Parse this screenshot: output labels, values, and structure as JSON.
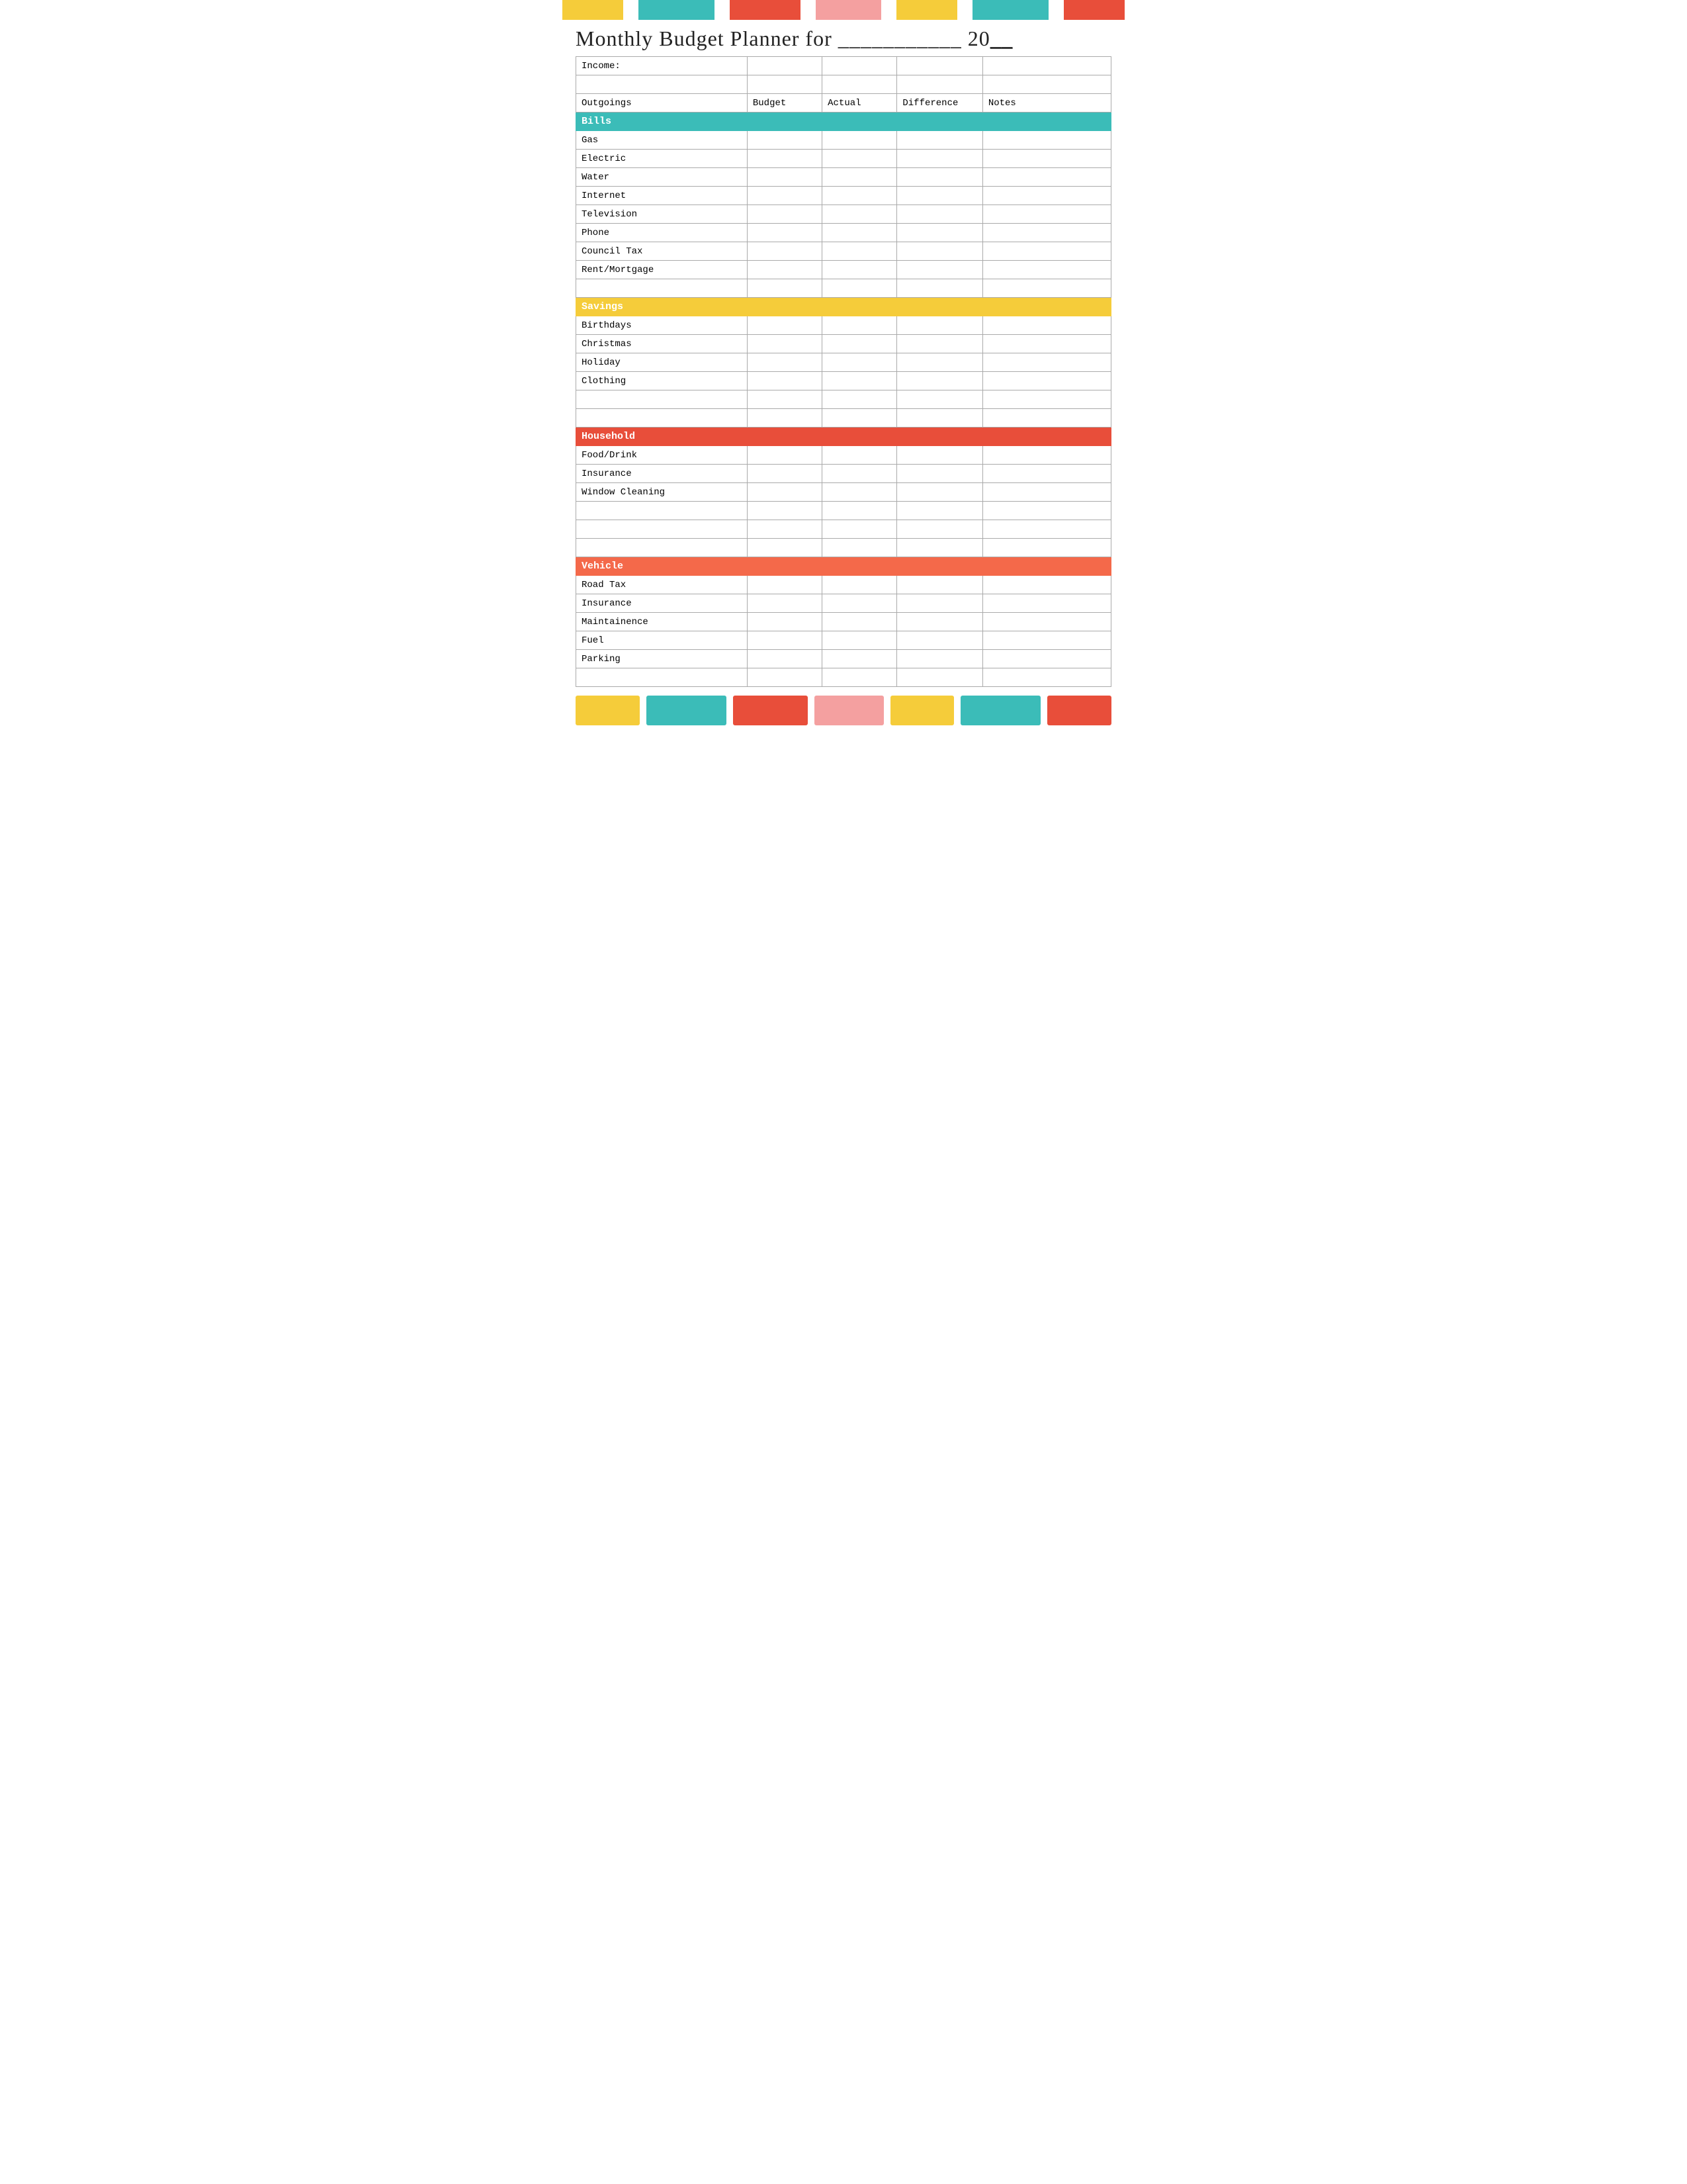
{
  "topBar": [
    {
      "color": "#F5CC3A",
      "flex": 1.2
    },
    {
      "color": "#ffffff",
      "flex": 0.3
    },
    {
      "color": "#3BBCB8",
      "flex": 1.5
    },
    {
      "color": "#ffffff",
      "flex": 0.3
    },
    {
      "color": "#E84E3A",
      "flex": 1.4
    },
    {
      "color": "#ffffff",
      "flex": 0.3
    },
    {
      "color": "#F4A0A0",
      "flex": 1.3
    },
    {
      "color": "#ffffff",
      "flex": 0.3
    },
    {
      "color": "#F5CC3A",
      "flex": 1.2
    },
    {
      "color": "#ffffff",
      "flex": 0.3
    },
    {
      "color": "#3BBCB8",
      "flex": 1.5
    },
    {
      "color": "#ffffff",
      "flex": 0.3
    },
    {
      "color": "#E84E3A",
      "flex": 1.2
    }
  ],
  "title": "Monthly Budget Planner for ",
  "titleLine": "___________",
  "titleYear": " 20",
  "titleYearLine": "__",
  "table": {
    "incomeLabel": "Income:",
    "headers": {
      "outgoings": "Outgoings",
      "budget": "Budget",
      "actual": "Actual",
      "difference": "Difference",
      "notes": "Notes"
    },
    "sections": [
      {
        "type": "section-teal",
        "label": "Bills",
        "rows": [
          "Gas",
          "Electric",
          "Water",
          "Internet",
          "Television",
          "Phone",
          "Council Tax",
          "Rent/Mortgage",
          ""
        ]
      },
      {
        "type": "section-yellow",
        "label": "Savings",
        "rows": [
          "Birthdays",
          "Christmas",
          "Holiday",
          "Clothing",
          "",
          ""
        ]
      },
      {
        "type": "section-red",
        "label": "Household",
        "rows": [
          "Food/Drink",
          "Insurance",
          "Window Cleaning",
          "",
          "",
          ""
        ]
      },
      {
        "type": "section-coral",
        "label": "Vehicle",
        "rows": [
          "Road Tax",
          "Insurance",
          "Maintainence",
          "Fuel",
          "Parking",
          ""
        ]
      }
    ]
  },
  "bottomBar": [
    {
      "color": "#F5CC3A",
      "flex": 1.2
    },
    {
      "color": "#3BBCB8",
      "flex": 1.5
    },
    {
      "color": "#E84E3A",
      "flex": 1.4
    },
    {
      "color": "#F4A0A0",
      "flex": 1.3
    },
    {
      "color": "#F5CC3A",
      "flex": 1.2
    },
    {
      "color": "#3BBCB8",
      "flex": 1.5
    },
    {
      "color": "#E84E3A",
      "flex": 1.2
    }
  ]
}
